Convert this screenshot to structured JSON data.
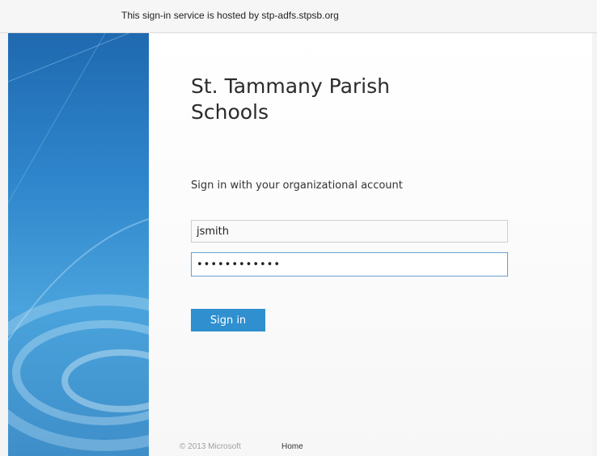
{
  "hosted_banner": "This sign-in service is hosted by stp-adfs.stpsb.org",
  "organization": {
    "title": "St. Tammany Parish Schools"
  },
  "signin": {
    "prompt": "Sign in with your organizational account",
    "username_value": "jsmith",
    "password_value": "••••••••••••",
    "button_label": "Sign in"
  },
  "footer": {
    "copyright": "© 2013 Microsoft",
    "home_link": "Home"
  },
  "colors": {
    "accent": "#2f8fcf",
    "side_panel": "#2f86cc"
  }
}
